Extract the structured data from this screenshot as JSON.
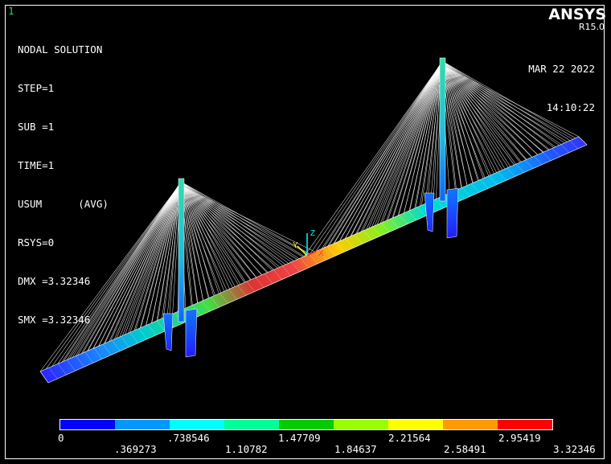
{
  "window_number": "1",
  "solution_info": {
    "title": "NODAL SOLUTION",
    "lines": [
      "STEP=1",
      "SUB =1",
      "TIME=1",
      "USUM      (AVG)",
      "RSYS=0",
      "DMX =3.32346",
      "SMX =3.32346"
    ]
  },
  "date": "MAR 22 2022",
  "time": "14:10:22",
  "logo": {
    "name": "ANSYS",
    "version": "R15.0"
  },
  "triad": {
    "x_label": "X",
    "y_label": "Y",
    "z_label": "Z"
  },
  "legend": {
    "colors": [
      "#0000ff",
      "#0099ff",
      "#00ffff",
      "#00ff99",
      "#00cc00",
      "#99ff00",
      "#ffff00",
      "#ff9900",
      "#ff0000"
    ],
    "top_labels": [
      "0",
      ".738546",
      "1.47709",
      "2.21564",
      "2.95419"
    ],
    "bottom_labels": [
      ".369273",
      "1.10782",
      "1.84637",
      "2.58491",
      "3.32346"
    ]
  }
}
